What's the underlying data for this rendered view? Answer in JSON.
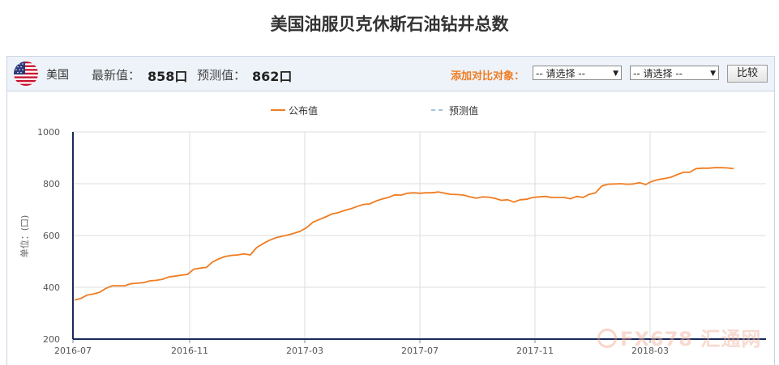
{
  "page": {
    "title": "美国油服贝克休斯石油钻井总数"
  },
  "toolbar": {
    "country": "美国",
    "latest_label": "最新值：",
    "latest_value": "858口",
    "forecast_label": "预测值：",
    "forecast_value": "862口",
    "compare_label": "添加对比对象：",
    "select1_value": "-- 请选择 --",
    "select2_value": "-- 请选择 --",
    "compare_button": "比较"
  },
  "watermark": {
    "text": "FX678 汇通网"
  },
  "chart_data": {
    "type": "line",
    "title": "",
    "xlabel": "",
    "ylabel": "单位：(口)",
    "ylim": [
      200,
      1000
    ],
    "yticks": [
      200,
      400,
      600,
      800,
      1000
    ],
    "xticks": [
      "2016-07",
      "2016-11",
      "2017-03",
      "2017-07",
      "2017-11",
      "2018-03"
    ],
    "legend": {
      "position": "top-center",
      "entries": [
        "公布值",
        "预测值"
      ]
    },
    "colors": {
      "published": "#f07c22",
      "forecast": "#7fb2d9",
      "grid": "#dcdcdc",
      "axis": "#1a2a5a"
    },
    "grid": true,
    "series": [
      {
        "name": "公布值",
        "values": [
          351,
          357,
          370,
          374,
          381,
          396,
          406,
          406,
          406,
          414,
          416,
          418,
          425,
          427,
          431,
          440,
          443,
          447,
          450,
          470,
          474,
          477,
          498,
          510,
          519,
          523,
          525,
          529,
          525,
          553,
          568,
          581,
          591,
          597,
          602,
          609,
          617,
          631,
          652,
          662,
          672,
          683,
          688,
          697,
          703,
          712,
          720,
          722,
          733,
          741,
          747,
          757,
          756,
          763,
          765,
          763,
          765,
          765,
          768,
          763,
          759,
          758,
          756,
          749,
          744,
          749,
          748,
          743,
          736,
          738,
          729,
          738,
          740,
          747,
          749,
          751,
          747,
          747,
          747,
          742,
          751,
          747,
          759,
          765,
          791,
          798,
          799,
          800,
          798,
          799,
          804,
          797,
          809,
          816,
          820,
          825,
          835,
          844,
          844,
          858,
          860,
          860,
          862,
          862,
          861,
          858
        ]
      },
      {
        "name": "预测值",
        "values": []
      }
    ]
  }
}
